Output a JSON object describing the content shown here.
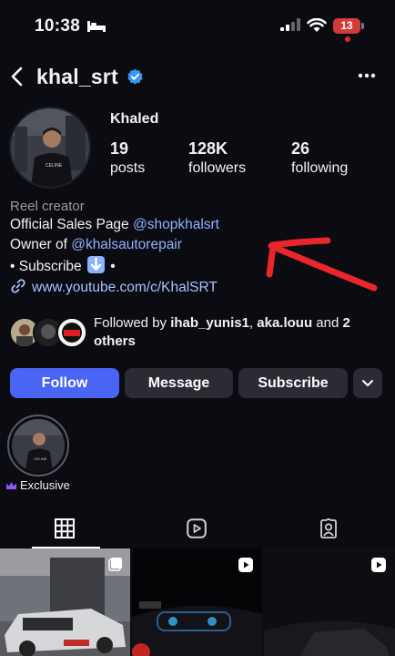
{
  "status_bar": {
    "time": "10:38",
    "battery": "13"
  },
  "header": {
    "username": "khal_srt"
  },
  "profile": {
    "display_name": "Khaled",
    "stats": [
      {
        "value": "19",
        "label": "posts"
      },
      {
        "value": "128K",
        "label": "followers"
      },
      {
        "value": "26",
        "label": "following"
      }
    ],
    "category": "Reel creator",
    "bio": {
      "line1_text": "Official Sales Page ",
      "line1_mention": "@shopkhalsrt",
      "line2_text": "Owner of ",
      "line2_mention": "@khalsautorepair",
      "line3_start": "• Subscribe",
      "line3_end": "•"
    },
    "link": "www.youtube.com/c/KhalSRT"
  },
  "followed_by": {
    "prefix": "Followed by ",
    "user1": "ihab_yunis1",
    "separator": ", ",
    "user2": "aka.louu",
    "conjunction": " and ",
    "others": "2 others"
  },
  "buttons": {
    "follow": "Follow",
    "message": "Message",
    "subscribe": "Subscribe"
  },
  "highlights": [
    {
      "label": "Exclusive"
    }
  ],
  "colors": {
    "accent_blue": "#4a64f3",
    "link_blue": "#8fb2ff",
    "annotation_red": "#e8262b",
    "verified_blue": "#3897f0"
  }
}
